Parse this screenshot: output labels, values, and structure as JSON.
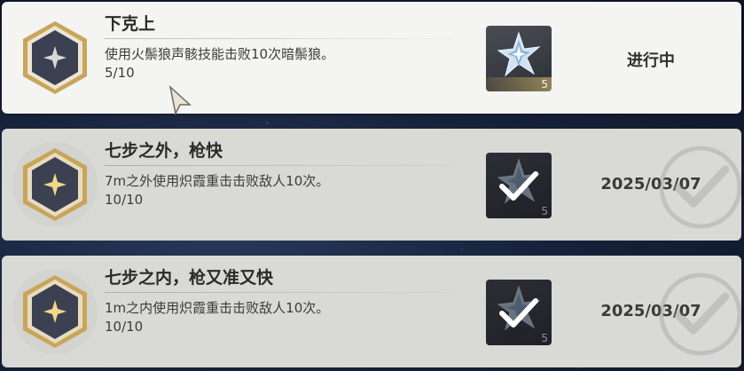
{
  "achievements": [
    {
      "title": "下克上",
      "description": "使用火鬃狼声骸技能击败10次暗鬃狼。",
      "progress": "5/10",
      "reward_count": "5",
      "status": "进行中",
      "state": "in-progress"
    },
    {
      "title": "七步之外，枪快",
      "description": "7m之外使用炽霞重击击败敌人10次。",
      "progress": "10/10",
      "reward_count": "5",
      "status": "2025/03/07",
      "state": "completed"
    },
    {
      "title": "七步之内，枪又准又快",
      "description": "1m之内使用炽霞重击击败敌人10次。",
      "progress": "10/10",
      "reward_count": "5",
      "status": "2025/03/07",
      "state": "completed"
    }
  ],
  "colors": {
    "card_active": "#f4f4f2",
    "card_done": "#d9d9d6",
    "emblem_gold": "#c9a55a",
    "emblem_dark": "#3b4150"
  },
  "icons": {
    "emblem": "hexagon-star-emblem-icon",
    "reward": "crystal-shard-icon",
    "claimed": "checkmark-icon",
    "cursor": "mouse-cursor-icon"
  }
}
